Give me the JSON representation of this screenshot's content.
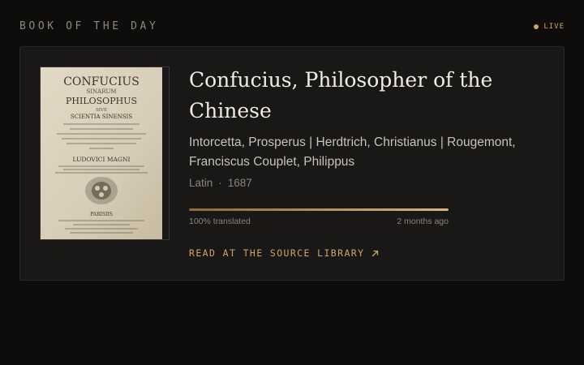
{
  "header": {
    "title": "BOOK OF THE DAY",
    "live_label": "LIVE"
  },
  "book": {
    "cover": {
      "title_line1": "CONFUCIUS",
      "title_line2": "SINARUM",
      "title_line3": "PHILOSOPHUS",
      "title_line4": "SIVE",
      "title_line5": "SCIENTIA SINENSIS",
      "author_line": "LUDOVICI MAGNI",
      "city": "PARISIIS"
    },
    "title": "Confucius, Philosopher of the Chinese",
    "authors": "Intorcetta, Prosperus | Herdtrich, Christianus | Rougemont, Franciscus Couplet, Philippus",
    "language": "Latin",
    "separator": "·",
    "year": "1687",
    "progress": {
      "percent": 100,
      "label": "100% translated",
      "updated": "2 months ago"
    },
    "link_label": "READ AT THE SOURCE LIBRARY"
  },
  "icons": {
    "live": "dot-icon",
    "link": "arrow-up-right-icon"
  },
  "colors": {
    "background": "#0e0d0c",
    "card": "#1a1816",
    "accent": "#c9a668",
    "title": "#f1ece3"
  }
}
